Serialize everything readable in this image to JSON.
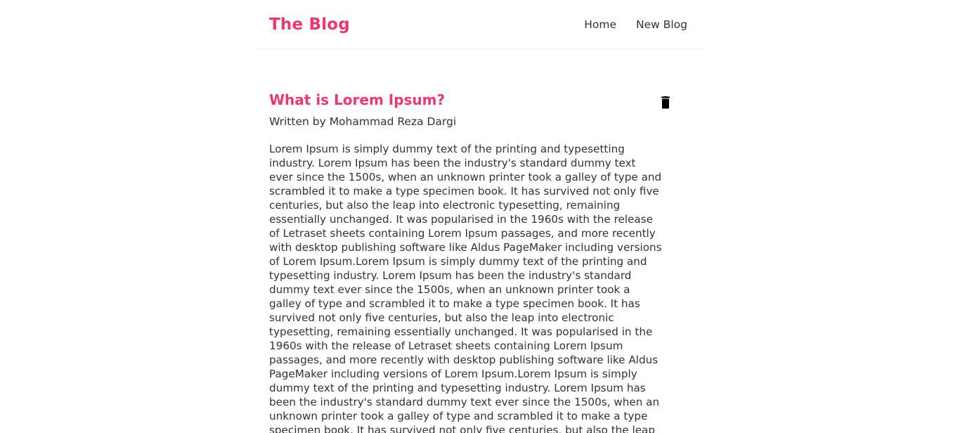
{
  "navbar": {
    "brand": "The Blog",
    "links": [
      "Home",
      "New Blog"
    ]
  },
  "blog": {
    "title": "What is Lorem Ipsum?",
    "author_line": "Written by Mohammad Reza Dargi",
    "delete_icon": "trash-icon",
    "body": "Lorem Ipsum is simply dummy text of the printing and typesetting industry. Lorem Ipsum has been the industry's standard dummy text ever since the 1500s, when an unknown printer took a galley of type and scrambled it to make a type specimen book. It has survived not only five centuries, but also the leap into electronic typesetting, remaining essentially unchanged. It was popularised in the 1960s with the release of Letraset sheets containing Lorem Ipsum passages, and more recently with desktop publishing software like Aldus PageMaker including versions of Lorem Ipsum.Lorem Ipsum is simply dummy text of the printing and typesetting industry. Lorem Ipsum has been the industry's standard dummy text ever since the 1500s, when an unknown printer took a galley of type and scrambled it to make a type specimen book. It has survived not only five centuries, but also the leap into electronic typesetting, remaining essentially unchanged. It was popularised in the 1960s with the release of Letraset sheets containing Lorem Ipsum passages, and more recently with desktop publishing software like Aldus PageMaker including versions of Lorem Ipsum.Lorem Ipsum is simply dummy text of the printing and typesetting industry. Lorem Ipsum has been the industry's standard dummy text ever since the 1500s, when an unknown printer took a galley of type and scrambled it to make a type specimen book. It has survived not only five centuries, but also the leap into electronic typesetting, remaining essentially unchanged. It was"
  },
  "colors": {
    "accent": "#f1356d",
    "text": "#333333"
  }
}
